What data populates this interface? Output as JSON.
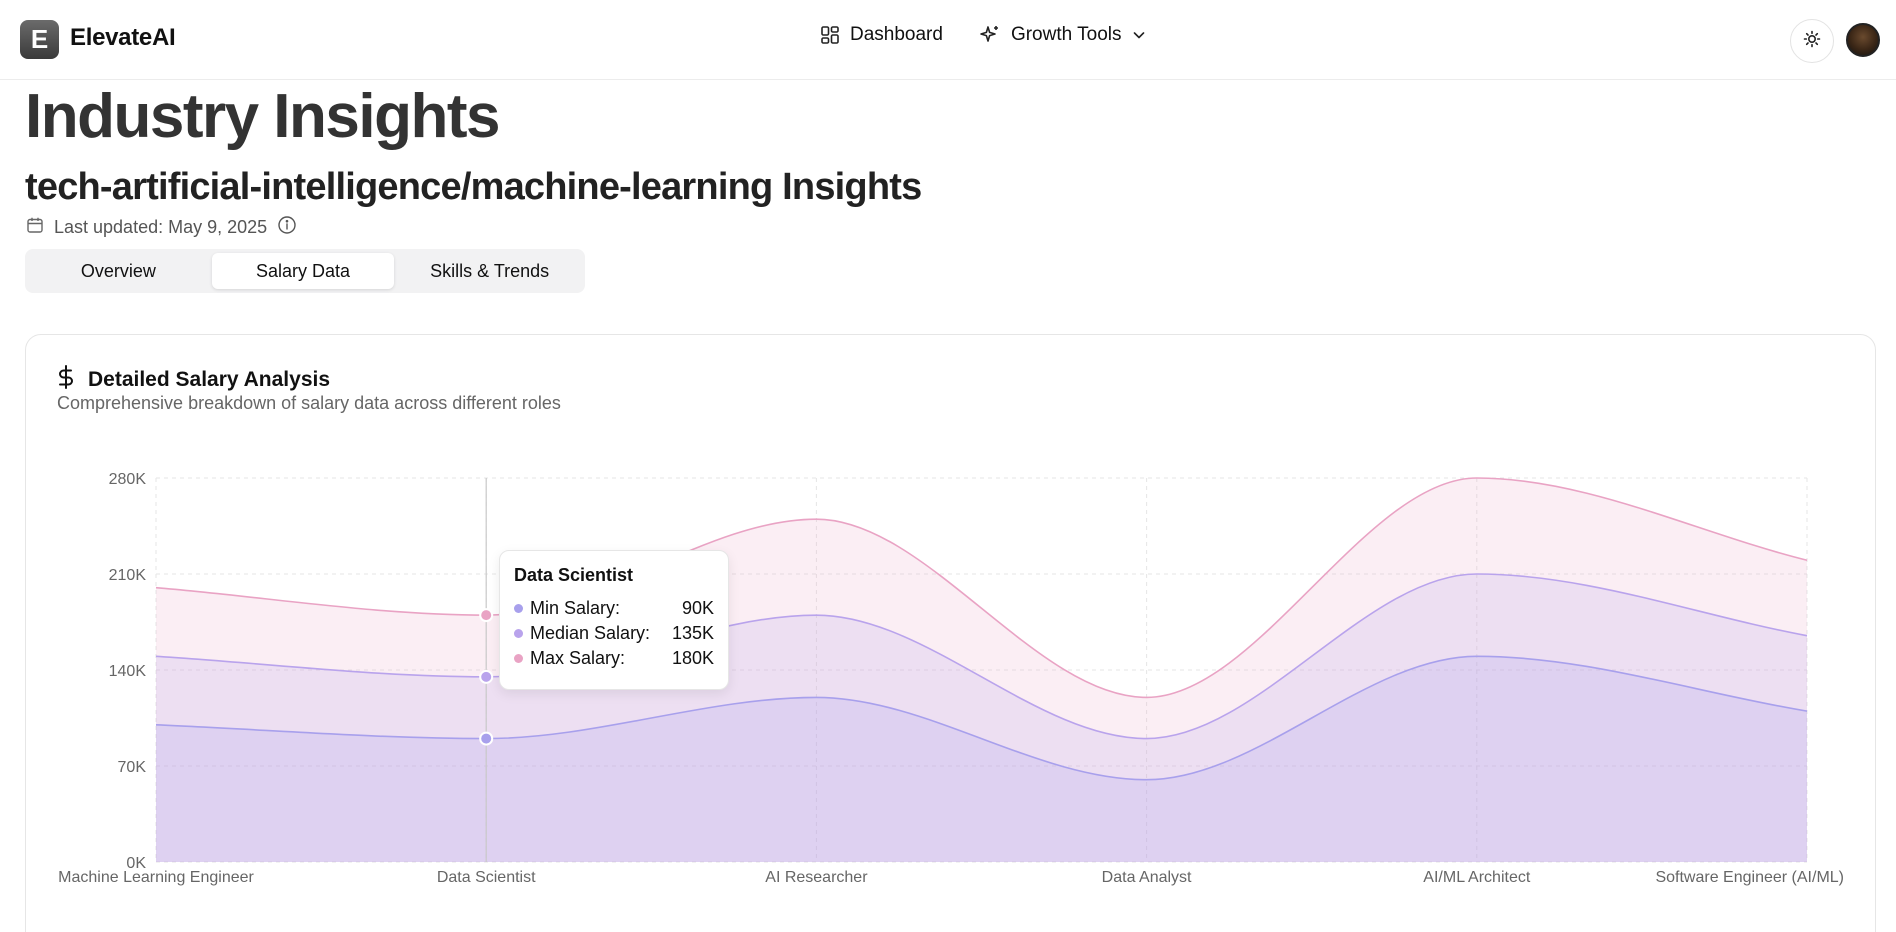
{
  "header": {
    "logo_letter": "E",
    "brand": "ElevateAI",
    "nav": [
      {
        "label": "Dashboard",
        "icon": "dashboard-grid-icon"
      },
      {
        "label": "Growth Tools",
        "icon": "sparkles-icon"
      }
    ],
    "theme_toggle_icon": "sun-icon"
  },
  "page": {
    "title": "Industry Insights",
    "subtitle": "tech-artificial-intelligence/machine-learning Insights",
    "last_updated": "Last updated: May 9, 2025"
  },
  "tabs": [
    {
      "label": "Overview",
      "active": false
    },
    {
      "label": "Salary Data",
      "active": true
    },
    {
      "label": "Skills & Trends",
      "active": false
    }
  ],
  "card": {
    "title": "Detailed Salary Analysis",
    "description": "Comprehensive breakdown of salary data across different roles"
  },
  "tooltip": {
    "title": "Data Scientist",
    "rows": [
      {
        "label": "Min Salary:",
        "value": "90K"
      },
      {
        "label": "Median Salary:",
        "value": "135K"
      },
      {
        "label": "Max Salary:",
        "value": "180K"
      }
    ]
  },
  "colors": {
    "min": "#a8a0ec",
    "median": "#b9a3ec",
    "max": "#e9a3c4"
  },
  "chart_data": {
    "type": "area",
    "categories": [
      "Machine Learning Engineer",
      "Data Scientist",
      "AI Researcher",
      "Data Analyst",
      "AI/ML Architect",
      "Software Engineer (AI/ML)"
    ],
    "series": [
      {
        "name": "Min Salary",
        "values": [
          100,
          90,
          120,
          60,
          150,
          110
        ]
      },
      {
        "name": "Median Salary",
        "values": [
          150,
          135,
          180,
          90,
          210,
          165
        ]
      },
      {
        "name": "Max Salary",
        "values": [
          200,
          180,
          250,
          120,
          280,
          220
        ]
      }
    ],
    "y_ticks": [
      "0K",
      "70K",
      "140K",
      "210K",
      "280K"
    ],
    "ylim": [
      0,
      280
    ],
    "unit": "K",
    "grid": true,
    "legend": "bottom",
    "hovered_category": "Data Scientist"
  }
}
